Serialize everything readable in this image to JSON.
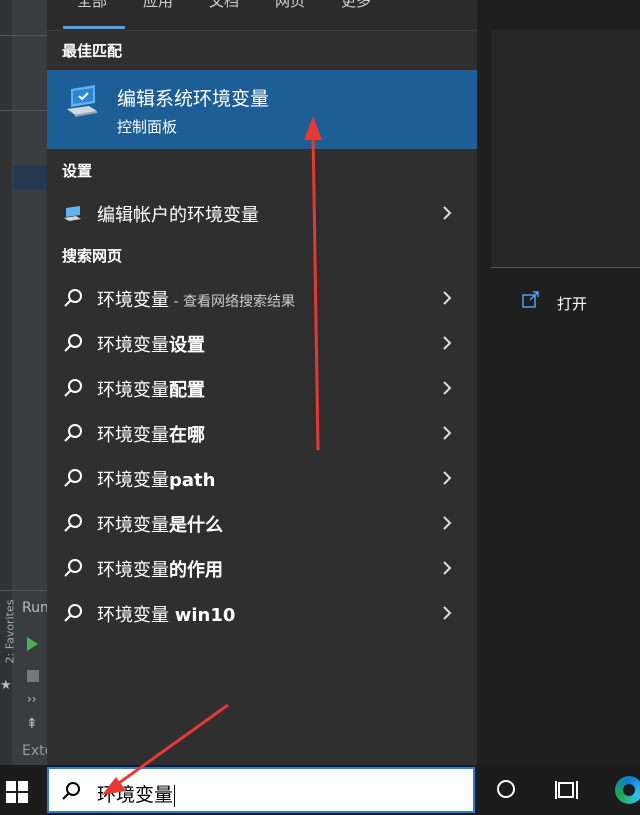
{
  "tabs": [
    "全部",
    "应用",
    "文档",
    "网页",
    "更多"
  ],
  "sections": {
    "best_match": "最佳匹配",
    "settings": "设置",
    "web": "搜索网页"
  },
  "best_match": {
    "title": "编辑系统环境变量",
    "subtitle": "控制面板",
    "icon": "system-properties-icon"
  },
  "settings_items": [
    {
      "label": "编辑帐户的环境变量",
      "icon": "settings-icon"
    }
  ],
  "web_items": [
    {
      "base": "环境变量",
      "bold": "",
      "hint": " - 查看网络搜索结果"
    },
    {
      "base": "环境变量",
      "bold": "设置",
      "hint": ""
    },
    {
      "base": "环境变量",
      "bold": "配置",
      "hint": ""
    },
    {
      "base": "环境变量",
      "bold": "在哪",
      "hint": ""
    },
    {
      "base": "环境变量",
      "bold": "path",
      "hint": ""
    },
    {
      "base": "环境变量",
      "bold": "是什么",
      "hint": ""
    },
    {
      "base": "环境变量",
      "bold": "的作用",
      "hint": ""
    },
    {
      "base": "环境变量 ",
      "bold": "win10",
      "hint": ""
    }
  ],
  "preview": {
    "open_label": "打开"
  },
  "search": {
    "value": "环境变量"
  },
  "ide": {
    "run": "Run",
    "favorites": "2: Favorites",
    "ext": "Exte"
  },
  "colors": {
    "highlight": "#1d5e97",
    "accent": "#2a7fd4",
    "arrow": "#e53935"
  }
}
